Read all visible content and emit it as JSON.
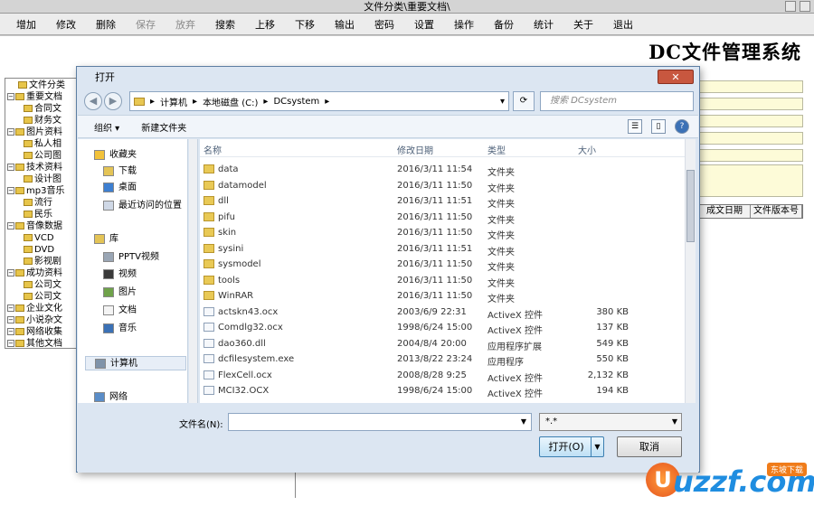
{
  "main_window": {
    "title": "文件分类\\重要文档\\",
    "app_title": "DC文件管理系统"
  },
  "menubar": [
    {
      "label": "增加",
      "enabled": true
    },
    {
      "label": "修改",
      "enabled": true
    },
    {
      "label": "删除",
      "enabled": true
    },
    {
      "label": "保存",
      "enabled": false
    },
    {
      "label": "放弃",
      "enabled": false
    },
    {
      "label": "搜索",
      "enabled": true
    },
    {
      "label": "上移",
      "enabled": true
    },
    {
      "label": "下移",
      "enabled": true
    },
    {
      "label": "输出",
      "enabled": true
    },
    {
      "label": "密码",
      "enabled": true
    },
    {
      "label": "设置",
      "enabled": true
    },
    {
      "label": "操作",
      "enabled": true
    },
    {
      "label": "备份",
      "enabled": true
    },
    {
      "label": "统计",
      "enabled": true
    },
    {
      "label": "关于",
      "enabled": true
    },
    {
      "label": "退出",
      "enabled": true
    }
  ],
  "tree": [
    {
      "label": "文件分类",
      "level": 0
    },
    {
      "label": "重要文档",
      "level": 1
    },
    {
      "label": "合同文",
      "level": 2
    },
    {
      "label": "财务文",
      "level": 2
    },
    {
      "label": "图片资料",
      "level": 1
    },
    {
      "label": "私人相",
      "level": 2
    },
    {
      "label": "公司图",
      "level": 2
    },
    {
      "label": "技术资料",
      "level": 1
    },
    {
      "label": "设计图",
      "level": 2
    },
    {
      "label": "mp3音乐",
      "level": 1
    },
    {
      "label": "流行",
      "level": 2
    },
    {
      "label": "民乐",
      "level": 2
    },
    {
      "label": "音像数据",
      "level": 1
    },
    {
      "label": "VCD",
      "level": 2
    },
    {
      "label": "DVD",
      "level": 2
    },
    {
      "label": "影视剧",
      "level": 2
    },
    {
      "label": "成功资料",
      "level": 1
    },
    {
      "label": "公司文",
      "level": 2
    },
    {
      "label": "公司文",
      "level": 2
    },
    {
      "label": "企业文化",
      "level": 1
    },
    {
      "label": "小说杂文",
      "level": 1
    },
    {
      "label": "网络收集",
      "level": 1
    },
    {
      "label": "其他文档",
      "level": 1
    }
  ],
  "grid_headers": [
    "成文日期",
    "文件版本号"
  ],
  "dialog": {
    "title": "打开",
    "close_label": "✕",
    "breadcrumb": [
      "计算机",
      "本地磁盘 (C:)",
      "DCsystem"
    ],
    "search_placeholder": "搜索 DCsystem",
    "organize_label": "组织 ▾",
    "new_folder_label": "新建文件夹",
    "nav": [
      {
        "label": "收藏夹",
        "icon": "star-icon"
      },
      {
        "label": "下载",
        "icon": "download-folder-icon"
      },
      {
        "label": "桌面",
        "icon": "desktop-icon"
      },
      {
        "label": "最近访问的位置",
        "icon": "recent-places-icon"
      },
      {
        "label": "库",
        "icon": "library-icon"
      },
      {
        "label": "PPTV视频",
        "icon": "video-library-icon"
      },
      {
        "label": "视频",
        "icon": "video-icon"
      },
      {
        "label": "图片",
        "icon": "picture-icon"
      },
      {
        "label": "文档",
        "icon": "document-icon"
      },
      {
        "label": "音乐",
        "icon": "music-icon"
      },
      {
        "label": "计算机",
        "icon": "computer-icon"
      },
      {
        "label": "网络",
        "icon": "network-icon"
      }
    ],
    "columns": [
      "名称",
      "修改日期",
      "类型",
      "大小"
    ],
    "files": [
      {
        "name": "data",
        "date": "2016/3/11 11:54",
        "type": "文件夹",
        "size": "",
        "folder": true
      },
      {
        "name": "datamodel",
        "date": "2016/3/11 11:50",
        "type": "文件夹",
        "size": "",
        "folder": true
      },
      {
        "name": "dll",
        "date": "2016/3/11 11:51",
        "type": "文件夹",
        "size": "",
        "folder": true
      },
      {
        "name": "pifu",
        "date": "2016/3/11 11:50",
        "type": "文件夹",
        "size": "",
        "folder": true
      },
      {
        "name": "skin",
        "date": "2016/3/11 11:50",
        "type": "文件夹",
        "size": "",
        "folder": true
      },
      {
        "name": "sysini",
        "date": "2016/3/11 11:51",
        "type": "文件夹",
        "size": "",
        "folder": true
      },
      {
        "name": "sysmodel",
        "date": "2016/3/11 11:50",
        "type": "文件夹",
        "size": "",
        "folder": true
      },
      {
        "name": "tools",
        "date": "2016/3/11 11:50",
        "type": "文件夹",
        "size": "",
        "folder": true
      },
      {
        "name": "WinRAR",
        "date": "2016/3/11 11:50",
        "type": "文件夹",
        "size": "",
        "folder": true
      },
      {
        "name": "actskn43.ocx",
        "date": "2003/6/9 22:31",
        "type": "ActiveX 控件",
        "size": "380 KB",
        "folder": false
      },
      {
        "name": "Comdlg32.ocx",
        "date": "1998/6/24 15:00",
        "type": "ActiveX 控件",
        "size": "137 KB",
        "folder": false
      },
      {
        "name": "dao360.dll",
        "date": "2004/8/4 20:00",
        "type": "应用程序扩展",
        "size": "549 KB",
        "folder": false
      },
      {
        "name": "dcfilesystem.exe",
        "date": "2013/8/22 23:24",
        "type": "应用程序",
        "size": "550 KB",
        "folder": false
      },
      {
        "name": "FlexCell.ocx",
        "date": "2008/8/28 9:25",
        "type": "ActiveX 控件",
        "size": "2,132 KB",
        "folder": false
      },
      {
        "name": "MCI32.OCX",
        "date": "1998/6/24 15:00",
        "type": "ActiveX 控件",
        "size": "194 KB",
        "folder": false
      }
    ],
    "filename_label": "文件名(N):",
    "filename_value": "",
    "filetype_value": "*.*",
    "open_label": "打开(O)",
    "cancel_label": "取消"
  },
  "watermark": {
    "text": "uzzf.com",
    "badge": "东坡下载"
  }
}
